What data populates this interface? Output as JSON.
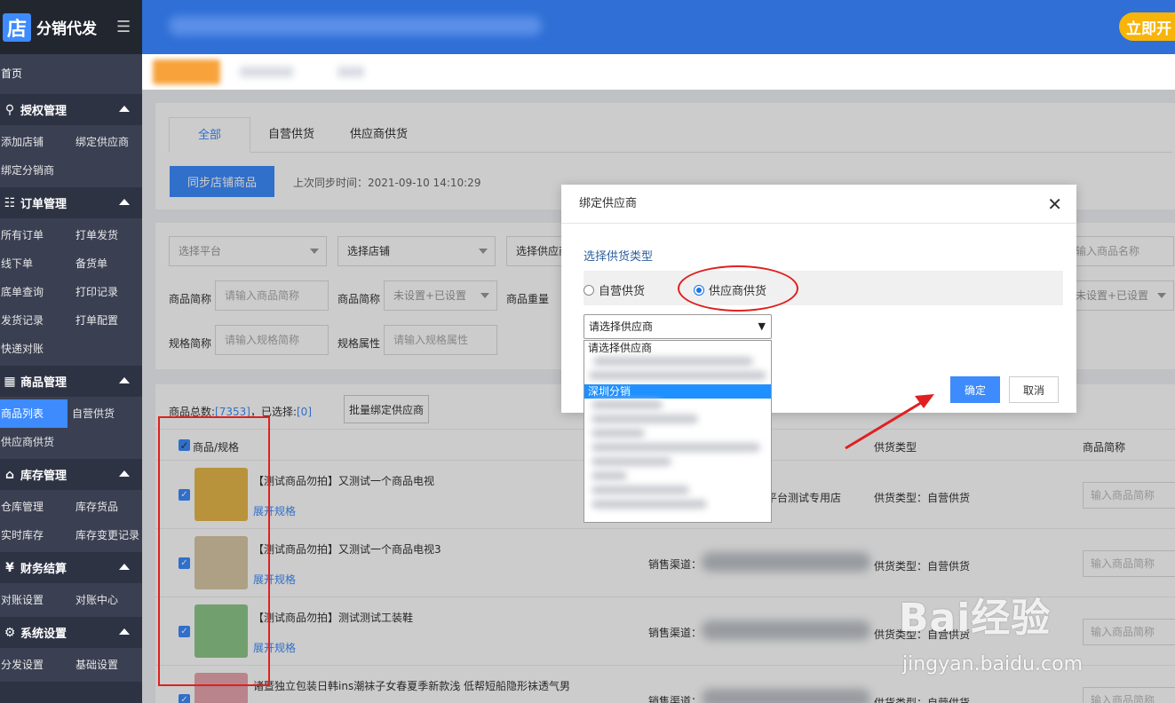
{
  "app": {
    "logo_char": "店",
    "name": "分销代发",
    "upgrade": "立即开"
  },
  "sidebar": {
    "home": "首页",
    "groups": [
      {
        "title": "授权管理",
        "icon": "user-icon",
        "rows": [
          [
            "添加店铺",
            "绑定供应商"
          ],
          [
            "绑定分销商",
            ""
          ]
        ]
      },
      {
        "title": "订单管理",
        "icon": "order-icon",
        "rows": [
          [
            "所有订单",
            "打单发货"
          ],
          [
            "线下单",
            "备货单"
          ],
          [
            "底单查询",
            "打印记录"
          ],
          [
            "发货记录",
            "打单配置"
          ],
          [
            "快递对账",
            ""
          ]
        ]
      },
      {
        "title": "商品管理",
        "icon": "grid-icon",
        "rows": [
          [
            "商品列表",
            "自营供货"
          ],
          [
            "供应商供货",
            ""
          ]
        ]
      },
      {
        "title": "库存管理",
        "icon": "home-icon",
        "rows": [
          [
            "仓库管理",
            "库存货品"
          ],
          [
            "实时库存",
            "库存变更记录"
          ]
        ]
      },
      {
        "title": "财务结算",
        "icon": "yen-icon",
        "rows": [
          [
            "对账设置",
            "对账中心"
          ]
        ]
      },
      {
        "title": "系统设置",
        "icon": "settings-icon",
        "rows": [
          [
            "分发设置",
            "基础设置"
          ]
        ]
      }
    ],
    "active_item": "商品列表"
  },
  "page": {
    "tabs": [
      "全部",
      "自营供货",
      "供应商供货"
    ],
    "sync_button": "同步店铺商品",
    "sync_time": "上次同步时间：2021-09-10 14:10:29",
    "filters": {
      "platform": "选择平台",
      "shop": "选择店铺",
      "supplier": "选择供应商",
      "name_placeholder": "输入商品名称",
      "abbr_label": "商品简称",
      "abbr_placeholder": "请输入商品简称",
      "abbr2_label": "商品简称",
      "abbr2_value": "未设置+已设置",
      "weight_label": "商品重量",
      "weight_value": "未设置+已设置",
      "spec_abbr_label": "规格简称",
      "spec_abbr_placeholder": "请输入规格简称",
      "spec_attr_label": "规格属性",
      "spec_attr_placeholder": "请输入规格属性"
    },
    "total_label": "商品总数:",
    "total_value": "[7353]",
    "selected_label": "，已选择:",
    "selected_value": "[0]",
    "batch_button": "批量绑定供应商",
    "columns": {
      "product": "商品/规格",
      "supply_type": "供货类型",
      "short_name": "商品简称"
    },
    "rows": [
      {
        "title": "【测试商品勿拍】又测试一个商品电视",
        "link": "展开规格",
        "channel": "",
        "store": "平台测试专用店",
        "type": "供货类型：自营供货",
        "name_placeholder": "输入商品简称"
      },
      {
        "title": "【测试商品勿拍】又测试一个商品电视3",
        "link": "展开规格",
        "channel": "销售渠道：",
        "store": "",
        "type": "供货类型：自营供货",
        "name_placeholder": "输入商品简称"
      },
      {
        "title": "【测试商品勿拍】测试测试工装鞋",
        "link": "展开规格",
        "channel": "销售渠道：",
        "store": "",
        "type": "供货类型：自营供货",
        "name_placeholder": "输入商品简称"
      },
      {
        "title": "诸暨独立包装日韩ins潮袜子女春夏季新款浅 低帮短船隐形袜透气男",
        "link": "",
        "channel": "销售渠道：",
        "store": "",
        "type": "供货类型：自营供货",
        "name_placeholder": "输入商品简称"
      }
    ]
  },
  "dialog": {
    "title": "绑定供应商",
    "subtitle": "选择供货类型",
    "radio_self": "自营供货",
    "radio_supplier": "供应商供货",
    "select_value": "请选择供应商",
    "options": [
      "请选择供应商",
      "深圳分销"
    ],
    "ok": "确定",
    "cancel": "取消"
  },
  "watermark": {
    "logo": "Bai经验",
    "url": "jingyan.baidu.com"
  }
}
